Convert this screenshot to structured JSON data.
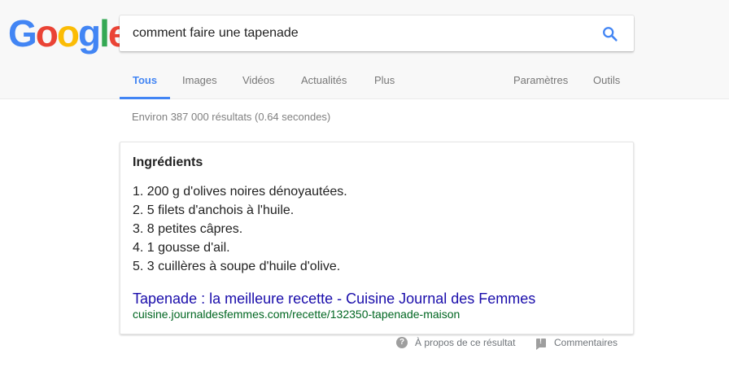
{
  "logo": {
    "letters": [
      "G",
      "o",
      "o",
      "g",
      "l",
      "e"
    ],
    "colors": [
      "#4285f4",
      "#ea4335",
      "#fbbc05",
      "#4285f4",
      "#34a853",
      "#ea4335"
    ]
  },
  "search": {
    "query": "comment faire une tapenade",
    "icon": "search-icon",
    "icon_color": "#4285f4"
  },
  "tabs": {
    "all": "Tous",
    "images": "Images",
    "videos": "Vidéos",
    "news": "Actualités",
    "more": "Plus",
    "settings": "Paramètres",
    "tools": "Outils"
  },
  "result_stats": "Environ 387 000 résultats (0.64 secondes)",
  "featured_snippet": {
    "title": "Ingrédients",
    "items": [
      "1. 200 g d'olives noires dénoyautées.",
      "2. 5 filets d'anchois à l'huile.",
      "3. 8 petites câpres.",
      "4. 1 gousse d'ail.",
      "5. 3 cuillères à soupe d'huile d'olive."
    ],
    "link_title": "Tapenade : la meilleure recette - Cuisine Journal des Femmes",
    "link_url": "cuisine.journaldesfemmes.com/recette/132350-tapenade-maison"
  },
  "footer": {
    "about": "À propos de ce résultat",
    "feedback": "Commentaires"
  }
}
